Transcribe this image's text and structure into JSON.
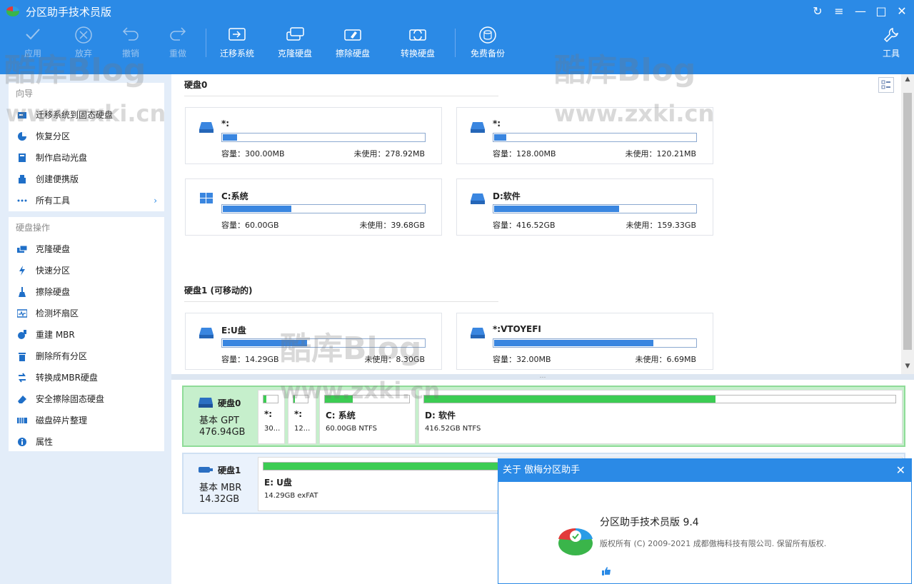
{
  "app": {
    "title": "分区助手技术员版"
  },
  "toolbar": {
    "apply": "应用",
    "discard": "放弃",
    "undo": "撤销",
    "redo": "重做",
    "migrate": "迁移系统",
    "clone": "克隆硬盘",
    "wipe": "擦除硬盘",
    "convert": "转换硬盘",
    "backup": "免费备份",
    "tools": "工具"
  },
  "sidebar": {
    "wizard_title": "向导",
    "wizard_items": [
      "迁移系统到固态硬盘",
      "恢复分区",
      "制作启动光盘",
      "创建便携版",
      "所有工具"
    ],
    "disk_ops_title": "硬盘操作",
    "disk_ops_items": [
      "克隆硬盘",
      "快速分区",
      "擦除硬盘",
      "检测坏扇区",
      "重建 MBR",
      "删除所有分区",
      "转换成MBR硬盘",
      "安全擦除固态硬盘",
      "磁盘碎片整理",
      "属性"
    ]
  },
  "disks_view": {
    "disk0_label": "硬盘0",
    "disk1_label": "硬盘1 (可移动的)",
    "partitions": [
      {
        "name": "*:",
        "capacity": "容量：300.00MB",
        "free": "未使用：278.92MB",
        "used_fraction": 0.07
      },
      {
        "name": "*:",
        "capacity": "容量：128.00MB",
        "free": "未使用：120.21MB",
        "used_fraction": 0.06
      },
      {
        "name": "C:系统",
        "capacity": "容量：60.00GB",
        "free": "未使用：39.68GB",
        "used_fraction": 0.34
      },
      {
        "name": "D:软件",
        "capacity": "容量：416.52GB",
        "free": "未使用：159.33GB",
        "used_fraction": 0.62
      },
      {
        "name": "E:U盘",
        "capacity": "容量：14.29GB",
        "free": "未使用：8.30GB",
        "used_fraction": 0.42
      },
      {
        "name": "*:VTOYEFI",
        "capacity": "容量：32.00MB",
        "free": "未使用：6.69MB",
        "used_fraction": 0.79
      }
    ]
  },
  "diskmap": {
    "disk0": {
      "name": "硬盘0",
      "type": "基本 GPT",
      "size": "476.94GB",
      "parts": [
        {
          "title": "*:",
          "sub": "30...",
          "used_fraction": 0.2
        },
        {
          "title": "*:",
          "sub": "12...",
          "used_fraction": 0.1
        },
        {
          "title": "C: 系统",
          "sub": "60.00GB NTFS",
          "used_fraction": 0.34
        },
        {
          "title": "D: 软件",
          "sub": "416.52GB NTFS",
          "used_fraction": 0.62
        }
      ]
    },
    "disk1": {
      "name": "硬盘1",
      "type": "基本 MBR",
      "size": "14.32GB",
      "parts": [
        {
          "title": "E: U盘",
          "sub": "14.29GB exFAT",
          "used_fraction": 0.42
        }
      ]
    }
  },
  "about_dialog": {
    "title": "关于 傲梅分区助手",
    "product": "分区助手技术员版 9.4",
    "copyright": "版权所有 (C) 2009-2021 成都傲梅科技有限公司. 保留所有版权."
  },
  "watermark": {
    "text1": "酷库Blog",
    "text2": "www.zxki.cn"
  },
  "colors": {
    "accent": "#2b8ae6",
    "used_bar": "#3a86e0",
    "map_bar": "#3ccc53",
    "selected_row": "#c6efcc"
  }
}
